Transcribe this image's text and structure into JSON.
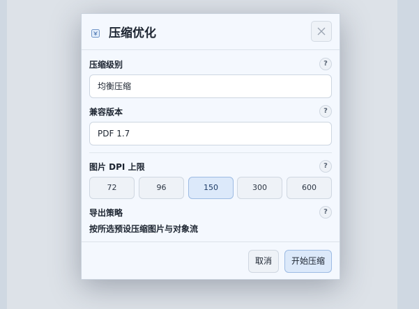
{
  "dialog": {
    "title": "压缩优化",
    "icon": "compress-icon",
    "close_icon": "close-icon"
  },
  "fields": {
    "level": {
      "label": "压缩级别",
      "value": "均衡压缩"
    },
    "version": {
      "label": "兼容版本",
      "value": "PDF 1.7"
    },
    "dpi": {
      "label": "图片 DPI 上限",
      "options": [
        "72",
        "96",
        "150",
        "300",
        "600"
      ],
      "selected": "150"
    },
    "strategy": {
      "label": "导出策略",
      "value": "按所选预设压缩图片与对象流"
    }
  },
  "help_label": "?",
  "footer": {
    "cancel_label": "取消",
    "start_label": "开始压缩"
  },
  "colors": {
    "accent": "#dce9fa",
    "accent_border": "#9dbbe3",
    "panel": "#f4f8fe"
  }
}
